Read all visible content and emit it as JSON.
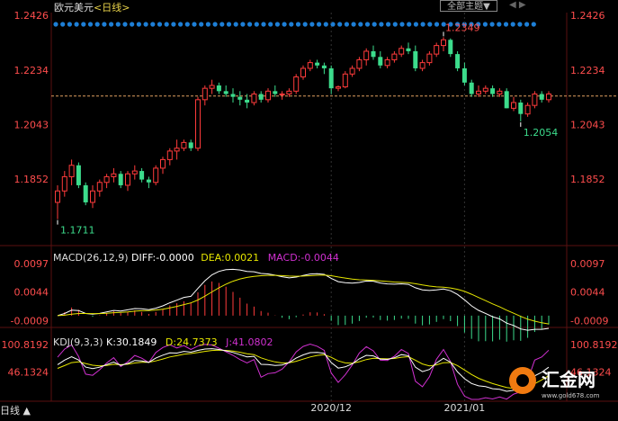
{
  "header": {
    "title": "欧元美元",
    "period": "<日线>",
    "theme_button": "全部主题▼",
    "nav_arrows": "◀ ▶"
  },
  "bottom_tab": "日线 ▲",
  "logo": {
    "name": "汇金网",
    "url": "www.gold678.com"
  },
  "colors": {
    "up": "#ff3b3b",
    "down": "#3cdc8c",
    "diff_line": "#ffffff",
    "dea_line": "#e6e600",
    "k_line": "#ffffff",
    "d_line": "#e6e600",
    "j_line": "#d030d0",
    "dot_row": "#1e7fd6"
  },
  "chart_data": [
    {
      "type": "candlestick",
      "title": "欧元美元<日线>",
      "yticks": [
        "1.2426",
        "1.2234",
        "1.2043",
        "1.1852"
      ],
      "ylim": [
        1.165,
        1.2426
      ],
      "xticks": [
        {
          "label": "2020/12",
          "index": 39
        },
        {
          "label": "2021/01",
          "index": 58
        }
      ],
      "reference_price": 1.2143,
      "annotations": [
        {
          "text": "1.2349",
          "index": 55,
          "kind": "high"
        },
        {
          "text": "1.2054",
          "index": 66,
          "kind": "low"
        },
        {
          "text": "1.1711",
          "index": 0,
          "kind": "low"
        }
      ],
      "candles": [
        [
          1.177,
          1.183,
          1.1711,
          1.181
        ],
        [
          1.181,
          1.188,
          1.179,
          1.186
        ],
        [
          1.186,
          1.192,
          1.183,
          1.19
        ],
        [
          1.19,
          1.191,
          1.182,
          1.183
        ],
        [
          1.183,
          1.184,
          1.176,
          1.177
        ],
        [
          1.177,
          1.183,
          1.175,
          1.181
        ],
        [
          1.181,
          1.185,
          1.179,
          1.184
        ],
        [
          1.184,
          1.187,
          1.182,
          1.186
        ],
        [
          1.186,
          1.189,
          1.184,
          1.187
        ],
        [
          1.187,
          1.188,
          1.182,
          1.183
        ],
        [
          1.183,
          1.188,
          1.181,
          1.187
        ],
        [
          1.187,
          1.19,
          1.185,
          1.188
        ],
        [
          1.188,
          1.189,
          1.184,
          1.185
        ],
        [
          1.185,
          1.186,
          1.182,
          1.184
        ],
        [
          1.184,
          1.19,
          1.183,
          1.189
        ],
        [
          1.189,
          1.193,
          1.187,
          1.192
        ],
        [
          1.192,
          1.196,
          1.19,
          1.195
        ],
        [
          1.195,
          1.199,
          1.192,
          1.196
        ],
        [
          1.196,
          1.199,
          1.195,
          1.198
        ],
        [
          1.198,
          1.199,
          1.195,
          1.196
        ],
        [
          1.196,
          1.214,
          1.195,
          1.213
        ],
        [
          1.213,
          1.218,
          1.211,
          1.217
        ],
        [
          1.217,
          1.22,
          1.215,
          1.218
        ],
        [
          1.218,
          1.219,
          1.215,
          1.216
        ],
        [
          1.216,
          1.218,
          1.214,
          1.215
        ],
        [
          1.215,
          1.217,
          1.212,
          1.214
        ],
        [
          1.214,
          1.216,
          1.211,
          1.213
        ],
        [
          1.213,
          1.215,
          1.21,
          1.212
        ],
        [
          1.212,
          1.216,
          1.211,
          1.215
        ],
        [
          1.215,
          1.216,
          1.212,
          1.213
        ],
        [
          1.213,
          1.217,
          1.212,
          1.216
        ],
        [
          1.216,
          1.218,
          1.214,
          1.215
        ],
        [
          1.215,
          1.216,
          1.213,
          1.215
        ],
        [
          1.215,
          1.217,
          1.214,
          1.216
        ],
        [
          1.216,
          1.222,
          1.215,
          1.221
        ],
        [
          1.221,
          1.225,
          1.22,
          1.224
        ],
        [
          1.224,
          1.227,
          1.223,
          1.226
        ],
        [
          1.226,
          1.227,
          1.224,
          1.225
        ],
        [
          1.225,
          1.226,
          1.222,
          1.224
        ],
        [
          1.224,
          1.225,
          1.215,
          1.217
        ],
        [
          1.217,
          1.218,
          1.216,
          1.2175
        ],
        [
          1.2175,
          1.223,
          1.217,
          1.222
        ],
        [
          1.222,
          1.225,
          1.221,
          1.224
        ],
        [
          1.224,
          1.228,
          1.223,
          1.227
        ],
        [
          1.227,
          1.231,
          1.225,
          1.23
        ],
        [
          1.23,
          1.232,
          1.227,
          1.228
        ],
        [
          1.228,
          1.23,
          1.224,
          1.225
        ],
        [
          1.225,
          1.228,
          1.224,
          1.227
        ],
        [
          1.227,
          1.23,
          1.226,
          1.229
        ],
        [
          1.229,
          1.232,
          1.228,
          1.231
        ],
        [
          1.231,
          1.233,
          1.229,
          1.23
        ],
        [
          1.23,
          1.232,
          1.223,
          1.224
        ],
        [
          1.224,
          1.227,
          1.223,
          1.226
        ],
        [
          1.226,
          1.23,
          1.225,
          1.229
        ],
        [
          1.229,
          1.233,
          1.228,
          1.232
        ],
        [
          1.232,
          1.2349,
          1.23,
          1.234
        ],
        [
          1.234,
          1.2345,
          1.228,
          1.229
        ],
        [
          1.229,
          1.23,
          1.223,
          1.224
        ],
        [
          1.224,
          1.226,
          1.218,
          1.219
        ],
        [
          1.219,
          1.22,
          1.214,
          1.215
        ],
        [
          1.215,
          1.218,
          1.214,
          1.216
        ],
        [
          1.216,
          1.218,
          1.215,
          1.217
        ],
        [
          1.217,
          1.218,
          1.214,
          1.215
        ],
        [
          1.215,
          1.217,
          1.214,
          1.216
        ],
        [
          1.216,
          1.217,
          1.21,
          1.21
        ],
        [
          1.21,
          1.214,
          1.209,
          1.212
        ],
        [
          1.212,
          1.213,
          1.2054,
          1.208
        ],
        [
          1.208,
          1.212,
          1.207,
          1.211
        ],
        [
          1.211,
          1.216,
          1.21,
          1.215
        ],
        [
          1.215,
          1.216,
          1.212,
          1.213
        ],
        [
          1.213,
          1.216,
          1.212,
          1.215
        ]
      ]
    },
    {
      "type": "macd",
      "params": "MACD(26,12,9)",
      "diff_label": "DIFF:-0.0000",
      "dea_label": "DEA:0.0021",
      "macd_label": "MACD:-0.0044",
      "yticks": [
        "0.0097",
        "0.0044",
        "-0.0009"
      ],
      "ylim": [
        -0.0032,
        0.0112
      ]
    },
    {
      "type": "kdj",
      "params": "KDJ(9,3,3)",
      "k_label": "K:30.1849",
      "d_label": "D:24.7373",
      "j_label": "J:41.0802",
      "yticks": [
        "100.8192",
        "46.1324"
      ],
      "ylim": [
        -8.0,
        110.0
      ]
    }
  ]
}
